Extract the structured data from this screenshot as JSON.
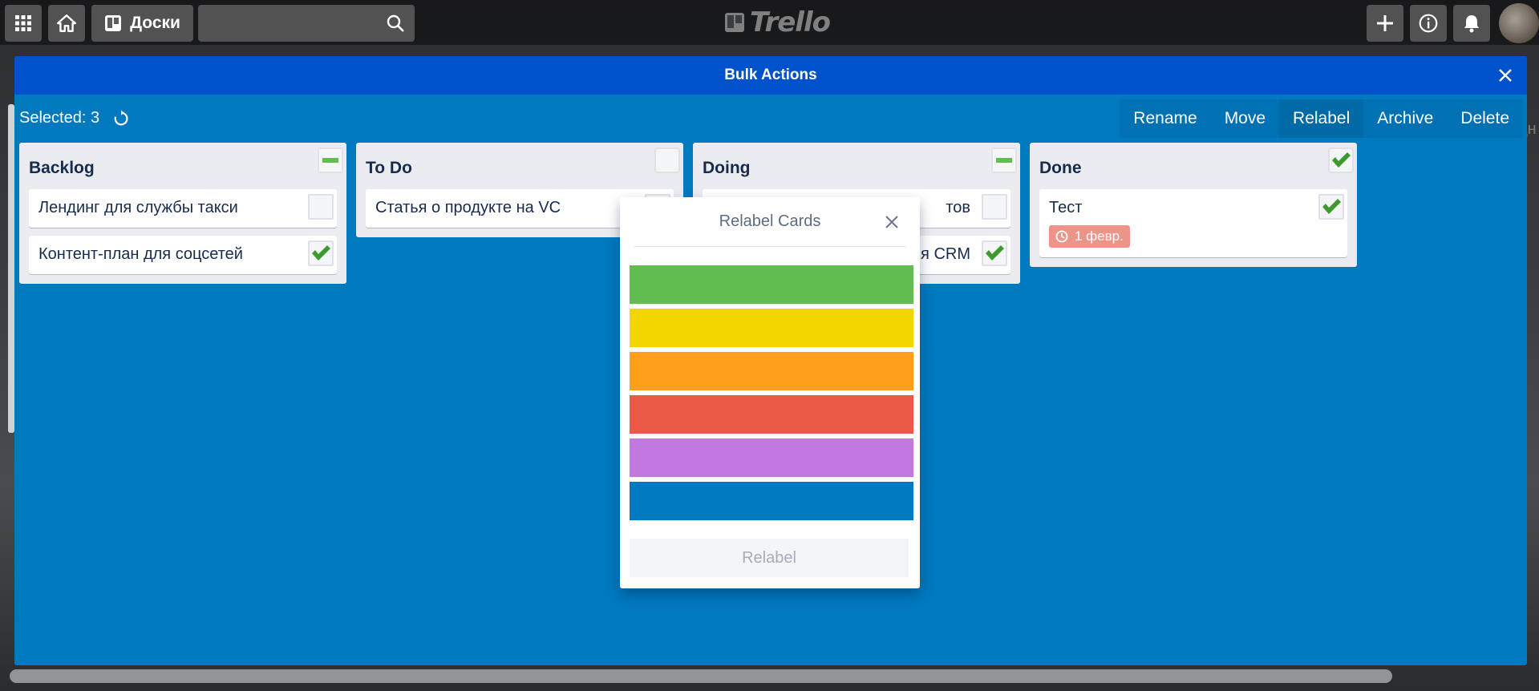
{
  "header": {
    "boards_label": "Доски",
    "search_placeholder": "",
    "logo_text": "Trello"
  },
  "modal": {
    "title": "Bulk Actions",
    "selected_label": "Selected: 3",
    "actions": [
      "Rename",
      "Move",
      "Relabel",
      "Archive",
      "Delete"
    ],
    "active_action": "Relabel"
  },
  "lists": [
    {
      "title": "Backlog",
      "state": "partial",
      "cards": [
        {
          "title": "Лендинг для службы такси",
          "checked": false
        },
        {
          "title": "Контент-план для соцсетей",
          "checked": true
        }
      ]
    },
    {
      "title": "To Do",
      "state": "unchecked",
      "cards": [
        {
          "title": "Статья о продукте на VC",
          "checked": false
        }
      ]
    },
    {
      "title": "Doing",
      "state": "partial",
      "cards": [
        {
          "title": "тов",
          "checked": false
        },
        {
          "title": "ля CRM",
          "checked": true
        }
      ]
    },
    {
      "title": "Done",
      "state": "checked",
      "cards": [
        {
          "title": "Тест",
          "checked": true,
          "due": "1 февр."
        }
      ]
    }
  ],
  "popup": {
    "title": "Relabel Cards",
    "colors": [
      "#61bd4f",
      "#f2d600",
      "#ff9f1a",
      "#eb5a46",
      "#c377e0",
      "#0079bf"
    ],
    "submit_label": "Relabel"
  },
  "background": {
    "right_edge_text": "дн"
  }
}
